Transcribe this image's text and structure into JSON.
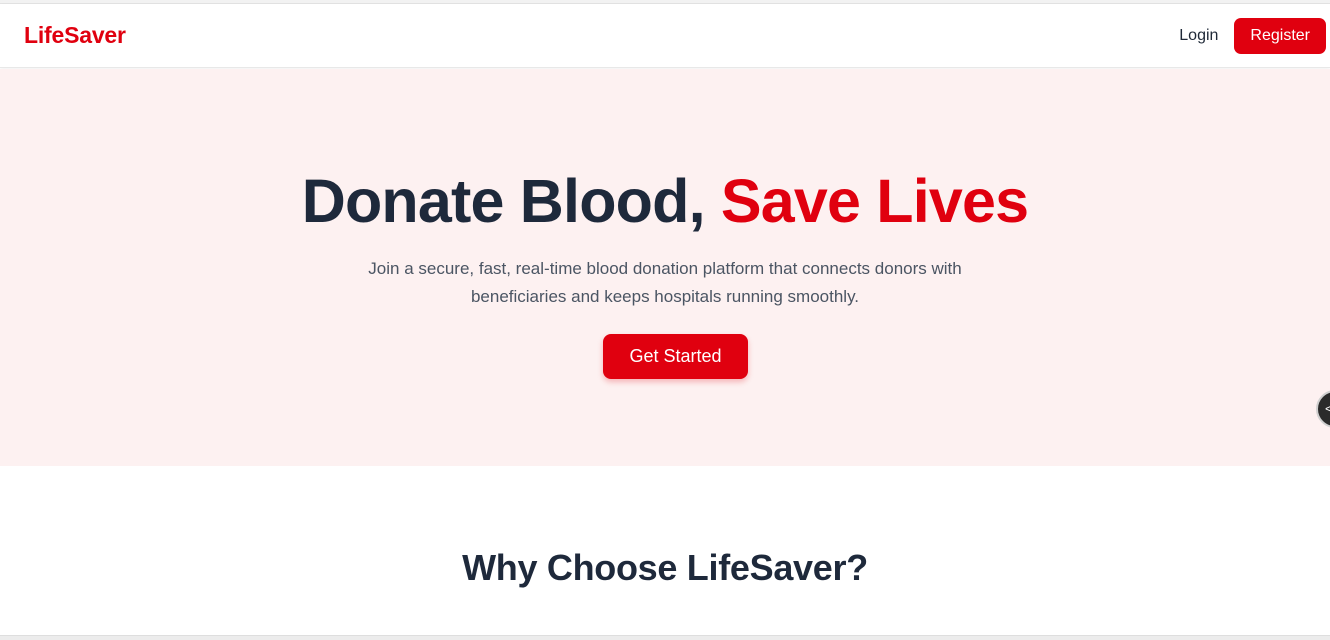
{
  "navbar": {
    "brand": "LifeSaver",
    "login_label": "Login",
    "register_label": "Register"
  },
  "hero": {
    "title_main": "Donate Blood,",
    "title_accent": "Save Lives",
    "subtitle": "Join a secure, fast, real-time blood donation platform that connects donors with beneficiaries and keeps hospitals running smoothly.",
    "cta_label": "Get Started"
  },
  "features": {
    "title": "Why Choose LifeSaver?"
  },
  "floating": {
    "icon": "code-icon"
  },
  "colors": {
    "brand_red": "#e0000f",
    "heading_dark": "#1e293b",
    "hero_background": "#fdf1f1",
    "body_text": "#4b5563"
  }
}
